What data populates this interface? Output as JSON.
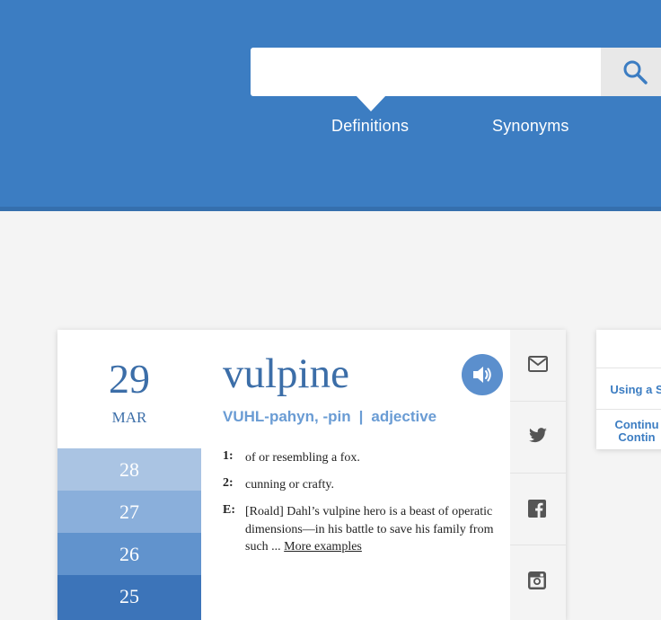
{
  "header": {
    "search": {
      "value": "",
      "placeholder": ""
    },
    "nav": [
      {
        "label": "Definitions"
      },
      {
        "label": "Synonyms"
      }
    ]
  },
  "word_of_day": {
    "date": {
      "day": "29",
      "month": "MAR"
    },
    "previous_days": [
      "28",
      "27",
      "26",
      "25"
    ],
    "word": "vulpine",
    "pronunciation": "VUHL-pahyn, -pin",
    "separator": "|",
    "part_of_speech": "adjective",
    "definitions": [
      {
        "num": "1:",
        "text": "of or resembling a fox."
      },
      {
        "num": "2:",
        "text": "cunning or crafty."
      }
    ],
    "example": {
      "num": "E:",
      "text": "[Roald] Dahl’s vulpine hero is a beast of operatic dimensions—in his battle to save his family from such ...",
      "more_link": "More examples"
    },
    "share_icons": [
      "envelope-icon",
      "twitter-icon",
      "facebook-icon",
      "instagram-icon"
    ]
  },
  "side_card": {
    "links": [
      "Using a S",
      "Continu",
      "Contin"
    ]
  },
  "colors": {
    "header_blue": "#3c7dc2",
    "accent_blue": "#3c6ea8",
    "prev_day_shades": [
      "#aac4e3",
      "#8aafdb",
      "#6193cd",
      "#3c74b9"
    ]
  }
}
